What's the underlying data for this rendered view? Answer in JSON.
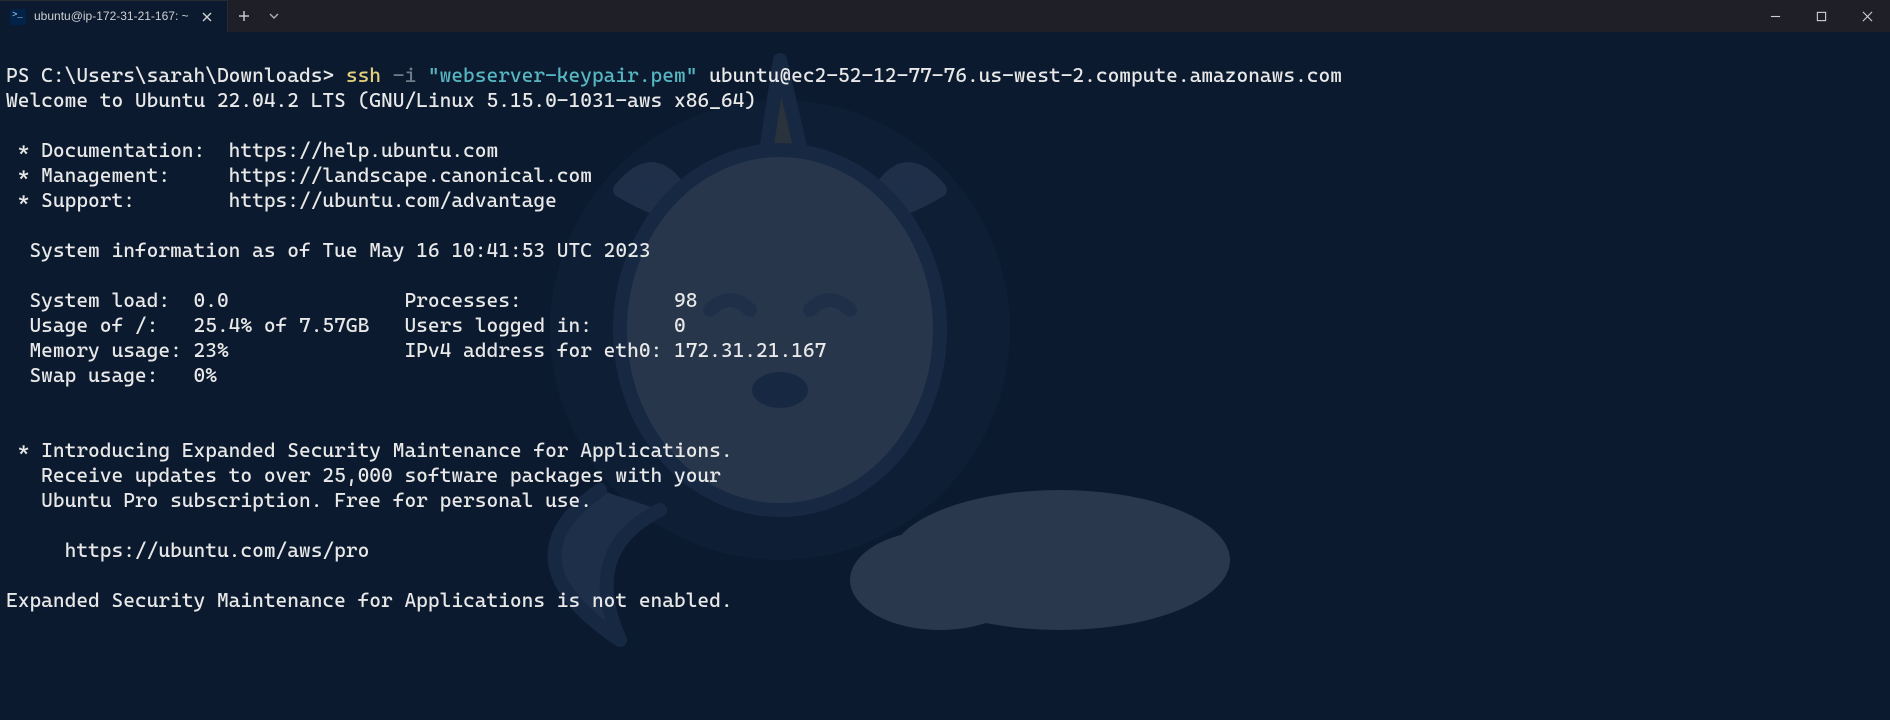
{
  "titlebar": {
    "tab_title": "ubuntu@ip-172-31-21-167: ~",
    "tab_icon": "powershell-icon"
  },
  "prompt": {
    "ps_prefix": "PS C:\\Users\\sarah\\Downloads> ",
    "cmd": "ssh ",
    "flag": "-i ",
    "arg_quoted": "\"webserver-keypair.pem\" ",
    "target": "ubuntu@ec2-52-12-77-76.us-west-2.compute.amazonaws.com"
  },
  "motd": {
    "welcome": "Welcome to Ubuntu 22.04.2 LTS (GNU/Linux 5.15.0-1031-aws x86_64)",
    "links": [
      " * Documentation:  https://help.ubuntu.com",
      " * Management:     https://landscape.canonical.com",
      " * Support:        https://ubuntu.com/advantage"
    ],
    "sysinfo_header": "  System information as of Tue May 16 10:41:53 UTC 2023",
    "sysinfo_rows": [
      "  System load:  0.0               Processes:             98",
      "  Usage of /:   25.4% of 7.57GB   Users logged in:       0",
      "  Memory usage: 23%               IPv4 address for eth0: 172.31.21.167",
      "  Swap usage:   0%"
    ],
    "esm_intro": [
      " * Introducing Expanded Security Maintenance for Applications.",
      "   Receive updates to over 25,000 software packages with your",
      "   Ubuntu Pro subscription. Free for personal use."
    ],
    "esm_url": "     https://ubuntu.com/aws/pro",
    "esm_status": "Expanded Security Maintenance for Applications is not enabled."
  }
}
